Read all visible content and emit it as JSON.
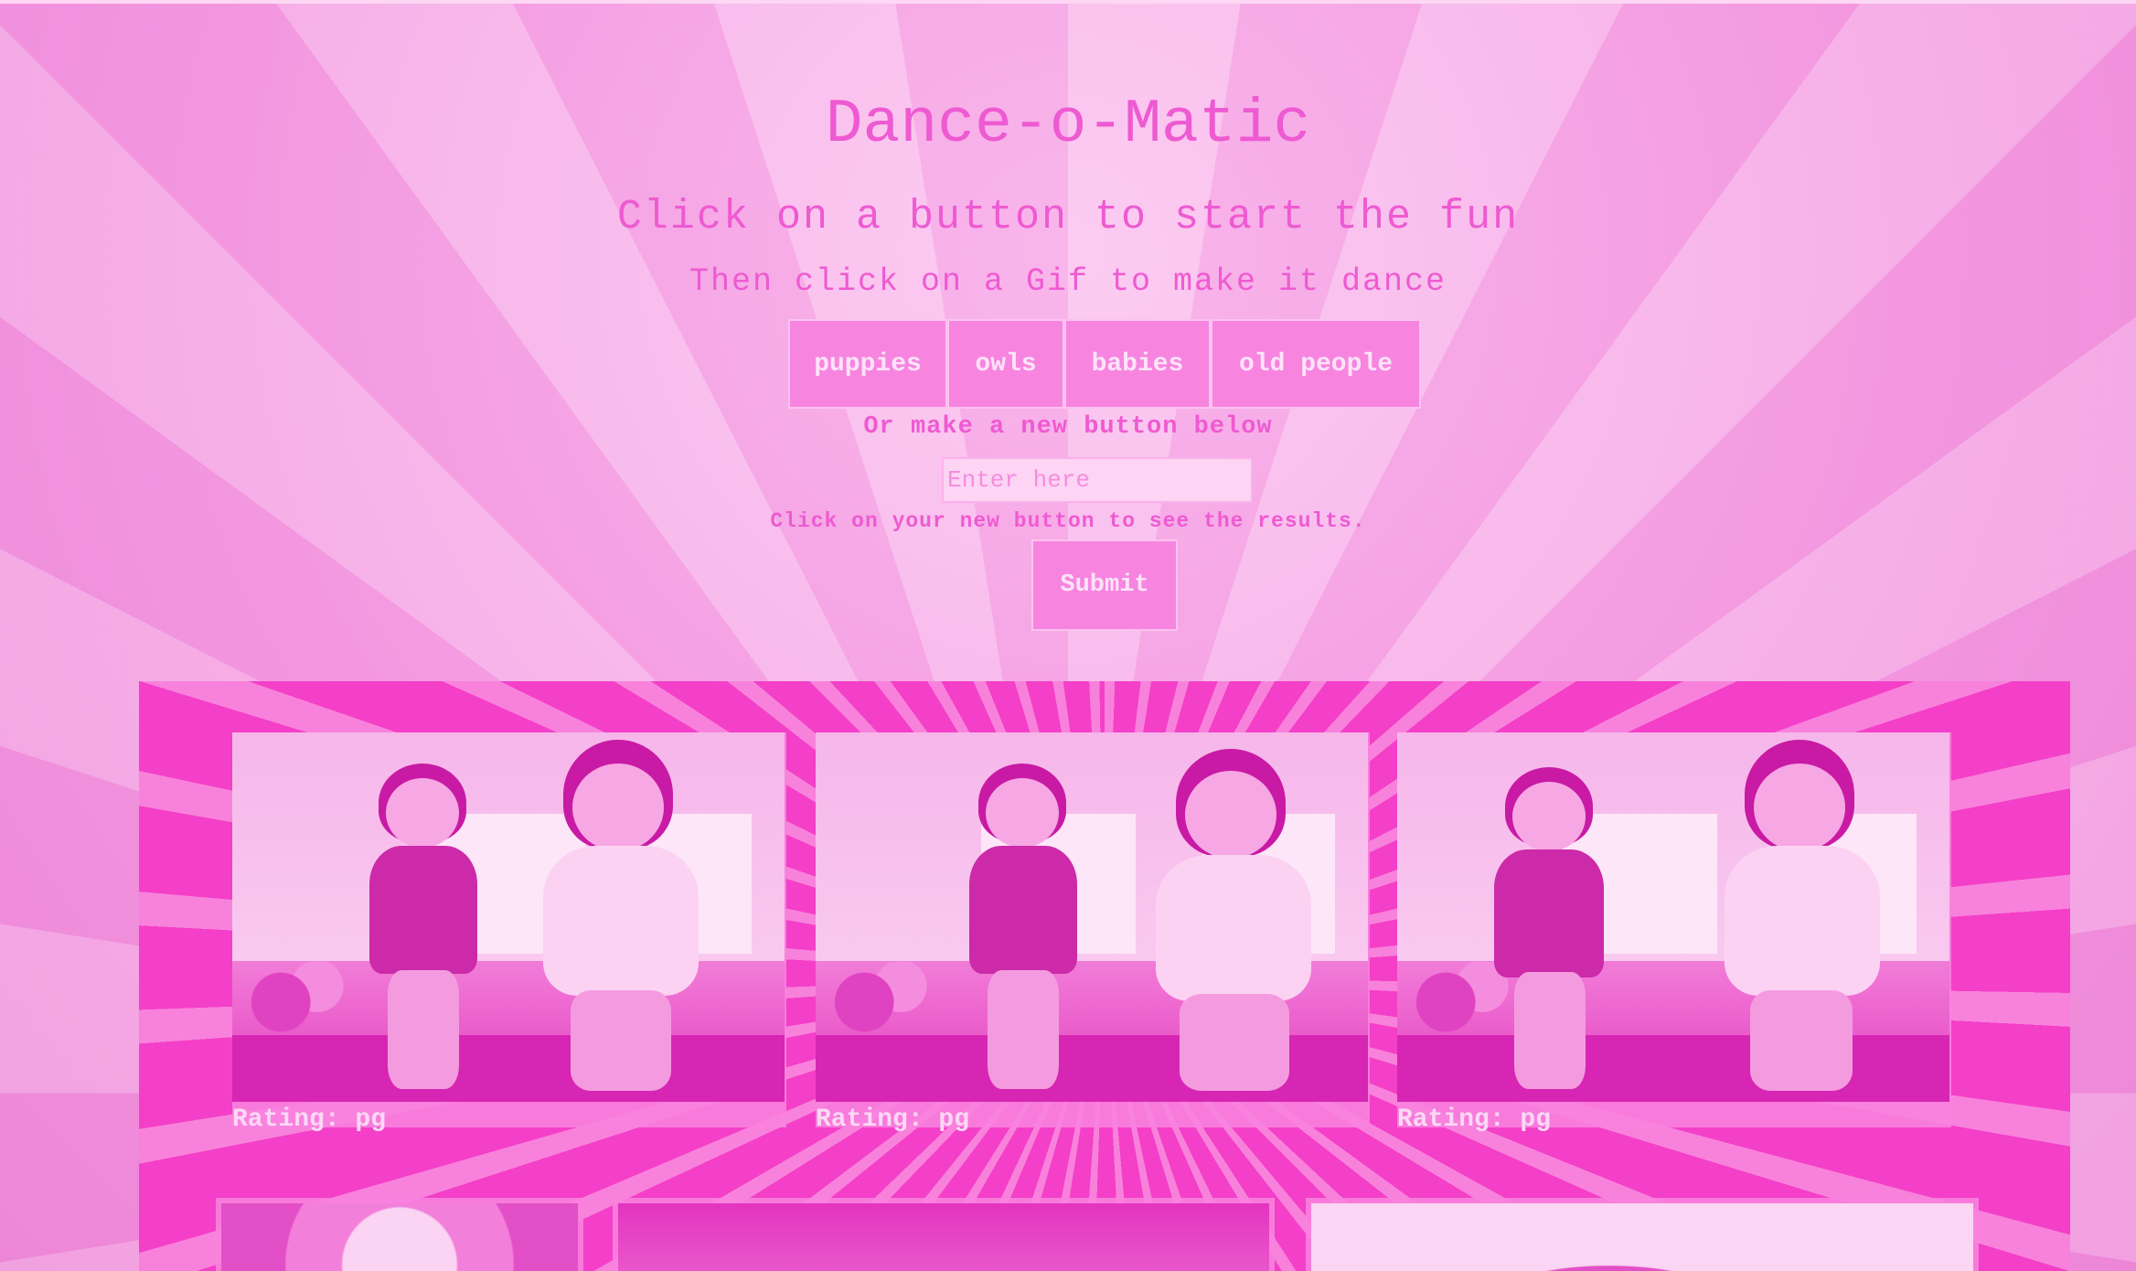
{
  "app": {
    "title": "Dance-o-Matic",
    "subtitle": "Click on a button to start the fun",
    "subtitle2": "Then click on a Gif to make it dance"
  },
  "topics": [
    {
      "label": "puppies"
    },
    {
      "label": "owls"
    },
    {
      "label": "babies"
    },
    {
      "label": "old people"
    }
  ],
  "new_button": {
    "prompt": "Or make a new button below",
    "placeholder": "Enter here",
    "hint": "Click on your new button to see the results.",
    "submit_label": "Submit"
  },
  "gifs": [
    {
      "rating_label": "Rating: pg"
    },
    {
      "rating_label": "Rating: pg"
    },
    {
      "rating_label": "Rating: pg"
    }
  ],
  "colors": {
    "accent": "#ee5ad1",
    "button_bg": "#f785e0",
    "panel_bg": "#f43fc8"
  }
}
